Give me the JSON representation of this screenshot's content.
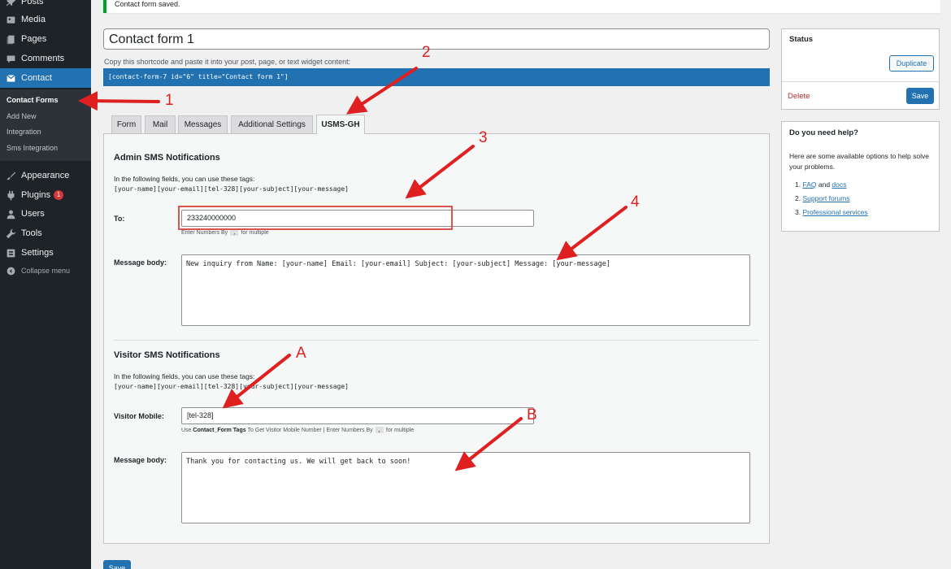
{
  "sidebar": {
    "items": [
      {
        "label": "Posts",
        "icon": "pin-icon"
      },
      {
        "label": "Media",
        "icon": "media-icon"
      },
      {
        "label": "Pages",
        "icon": "pages-icon"
      },
      {
        "label": "Comments",
        "icon": "comments-icon"
      },
      {
        "label": "Contact",
        "icon": "mail-icon"
      },
      {
        "label": "Appearance",
        "icon": "brush-icon"
      },
      {
        "label": "Plugins",
        "icon": "plug-icon",
        "badge": "1"
      },
      {
        "label": "Users",
        "icon": "user-icon"
      },
      {
        "label": "Tools",
        "icon": "wrench-icon"
      },
      {
        "label": "Settings",
        "icon": "settings-icon"
      },
      {
        "label": "Collapse menu",
        "icon": "collapse-icon"
      }
    ],
    "submenu": [
      "Contact Forms",
      "Add New",
      "Integration",
      "Sms Integration"
    ]
  },
  "notice": "Contact form saved.",
  "form_title": "Contact form 1",
  "shortcode_hint": "Copy this shortcode and paste it into your post, page, or text widget content:",
  "shortcode": "[contact-form-7 id=\"6\" title=\"Contact form 1\"]",
  "tabs": [
    "Form",
    "Mail",
    "Messages",
    "Additional Settings",
    "USMS-GH"
  ],
  "admin": {
    "heading": "Admin SMS Notifications",
    "hint": "In the following fields, you can use these tags:",
    "tags": "[your-name][your-email][tel-328][your-subject][your-message]",
    "to_label": "To:",
    "to_value": "233240000000",
    "to_note_pre": "Enter Numbers By",
    "to_note_sep": ",",
    "to_note_post": "for multiple",
    "body_label": "Message body:",
    "body_value": "New inquiry from Name: [your-name] Email: [your-email] Subject: [your-subject] Message: [your-message]"
  },
  "visitor": {
    "heading": "Visitor SMS Notifications",
    "hint": "In the following fields, you can use these tags:",
    "tags": "[your-name][your-email][tel-328][your-subject][your-message]",
    "mobile_label": "Visitor Mobile:",
    "mobile_value": "[tel-328]",
    "note_use": "Use",
    "note_bold": "Contact_Form Tags",
    "note_mid": "To Get Visitor Mobile Number | Enter Numbers By",
    "note_sep": ",",
    "note_post": "for multiple",
    "body_label": "Message body:",
    "body_value": "Thank you for contacting us. We will get back to soon!"
  },
  "status_box": {
    "title": "Status",
    "duplicate": "Duplicate",
    "delete": "Delete",
    "save": "Save"
  },
  "help_box": {
    "title": "Do you need help?",
    "intro": "Here are some available options to help solve your problems.",
    "items": [
      {
        "num": "1.",
        "links": [
          "FAQ",
          "docs"
        ],
        "joiner": "and"
      },
      {
        "num": "2.",
        "links": [
          "Support forums"
        ]
      },
      {
        "num": "3.",
        "links": [
          "Professional services"
        ]
      }
    ]
  },
  "bottom_save": "Save",
  "annotations": [
    "1",
    "2",
    "3",
    "4",
    "A",
    "B"
  ],
  "colors": {
    "accent": "#2271b1",
    "annotation": "#e02020",
    "sidebar": "#1d2327"
  }
}
